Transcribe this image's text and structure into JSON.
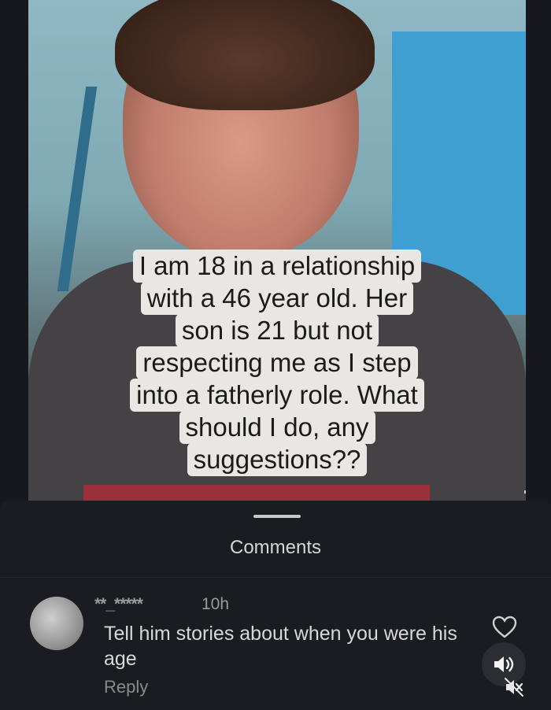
{
  "post": {
    "caption_lines": [
      "I am 18 in a relationship",
      "with a 46 year old. Her",
      "son is 21 but not",
      "respecting me as I step",
      "into a fatherly role. What",
      "should I do, any",
      "suggestions??"
    ]
  },
  "comments_panel": {
    "title": "Comments",
    "items": [
      {
        "username": "**_*****",
        "time": "10h",
        "text": "Tell him stories about when you were his age",
        "reply_label": "Reply"
      }
    ]
  },
  "icons": {
    "like": "heart-icon",
    "sound": "speaker-icon",
    "muted": "speaker-muted-icon",
    "avatar": "avatar"
  }
}
